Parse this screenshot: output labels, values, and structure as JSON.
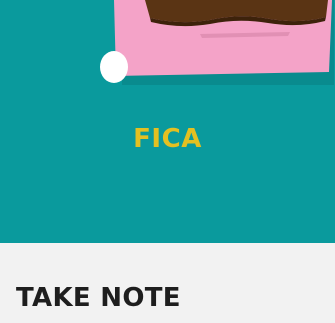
{
  "banner": {
    "label": "FICA",
    "background_color": "#0a9a9d",
    "label_color": "#e3c022",
    "illustration": {
      "icon": "pinned-note-with-chocolate-bar-illustration",
      "note_color": "#f4a3c8",
      "chocolate_color": "#5a3414",
      "pin_color": "#ffffff"
    }
  },
  "section": {
    "title": "TAKE NOTE"
  }
}
